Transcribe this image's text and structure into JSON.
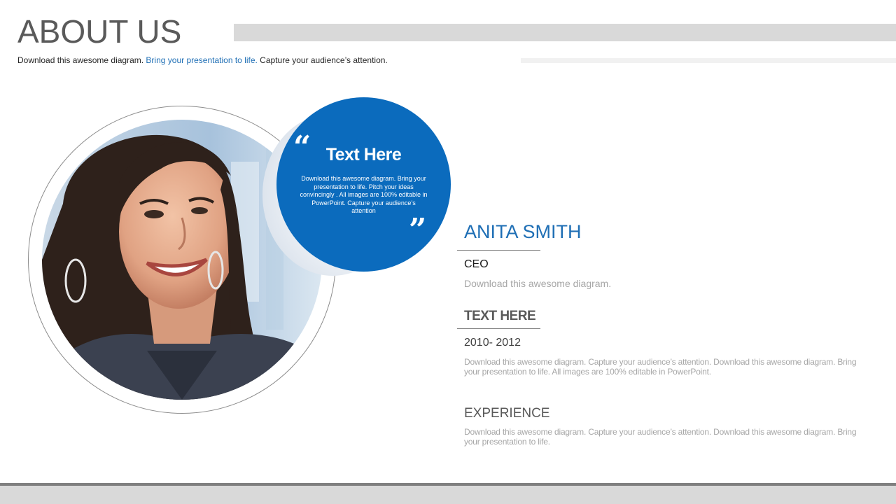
{
  "header": {
    "title": "ABOUT US",
    "subtitle_part1": "Download this awesome diagram. ",
    "subtitle_highlight": "Bring your presentation to life.",
    "subtitle_part2": " Capture your audience’s attention."
  },
  "quote": {
    "open_mark": "“",
    "close_mark": "”",
    "title": "Text Here",
    "body": "Download this awesome diagram. Bring your presentation to life. Pitch your ideas convincingly . All images are 100% editable in PowerPoint. Capture your audience’s attention"
  },
  "profile": {
    "name": "ANITA SMITH",
    "role": "CEO",
    "role_desc": "Download this awesome diagram."
  },
  "section": {
    "heading": "TEXT HERE",
    "years": "2010- 2012",
    "paragraph": "Download this awesome diagram. Capture your audience’s attention. Download this  awesome diagram. Bring your presentation to life. All images are 100% editable in PowerPoint."
  },
  "experience": {
    "heading": "EXPERIENCE",
    "paragraph": "Download this awesome diagram. Capture your audience’s attention. Download this  awesome diagram. Bring your presentation to life."
  },
  "colors": {
    "accent": "#0b6bbd",
    "title_gray": "#5a5a5a",
    "bar_gray": "#d9d9d9"
  }
}
